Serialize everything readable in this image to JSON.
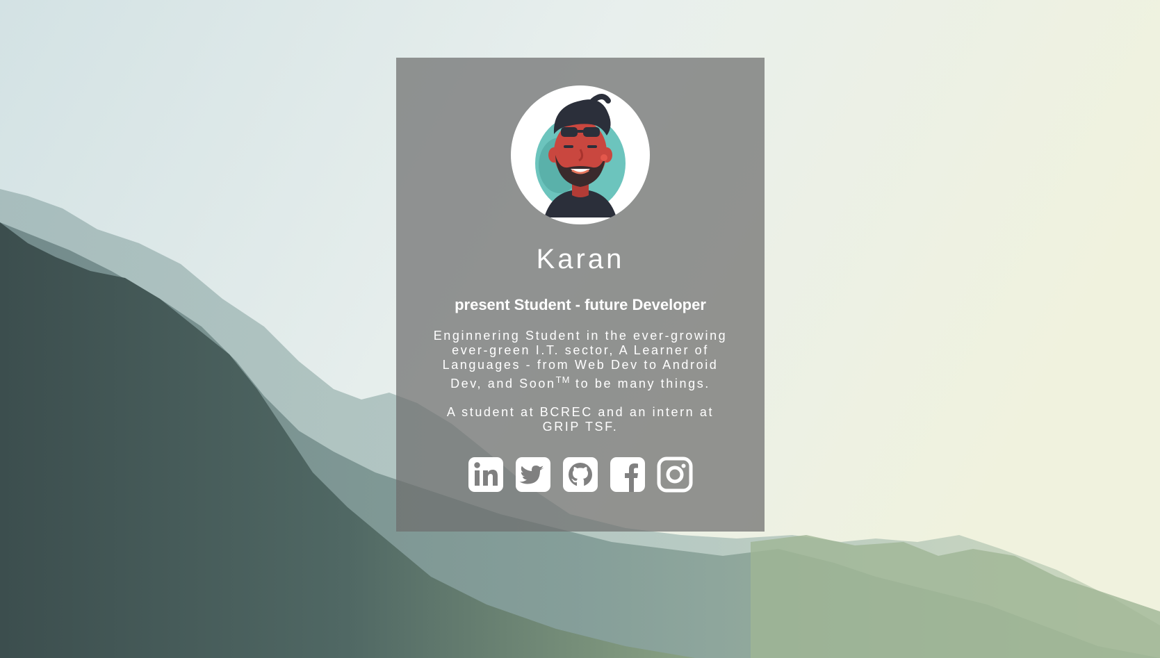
{
  "profile": {
    "name": "Karan",
    "tagline": "present Student - future Developer",
    "bio": "Enginnering Student in the ever-growing ever-green I.T. sector, A Learner of Languages - from Web Dev to Android Dev, and Soon",
    "bio_trademark": "TM",
    "bio_end": " to be many things.",
    "intern": "A student at BCREC and an intern at GRIP TSF."
  },
  "socials": [
    {
      "name": "linkedin",
      "icon": "linkedin-icon"
    },
    {
      "name": "twitter",
      "icon": "twitter-icon"
    },
    {
      "name": "github",
      "icon": "github-icon"
    },
    {
      "name": "facebook",
      "icon": "facebook-icon"
    },
    {
      "name": "instagram",
      "icon": "instagram-icon"
    }
  ],
  "colors": {
    "card_overlay": "#6e6e6e",
    "text": "#ffffff",
    "avatar_bg": "#6cc4bd",
    "skin": "#c9473f",
    "hair": "#2b2f3a"
  }
}
